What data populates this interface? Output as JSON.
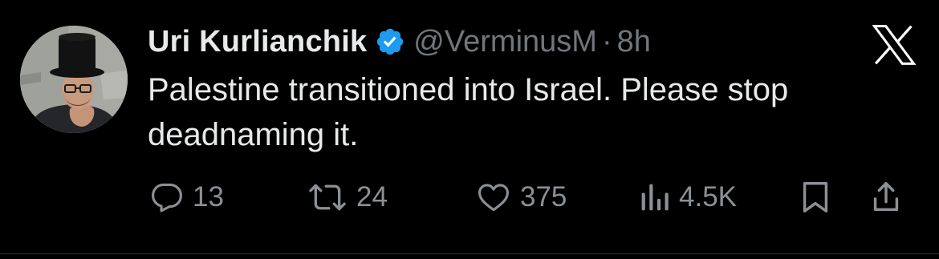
{
  "tweet": {
    "author": {
      "display_name": "Uri Kurlianchik",
      "handle": "@VerminusM",
      "verified": true,
      "separator": "·",
      "time": "8h"
    },
    "text": "Palestine transitioned into Israel. Please stop deadnaming it.",
    "metrics": {
      "replies": "13",
      "reposts": "24",
      "likes": "375",
      "views": "4.5K"
    }
  },
  "icons": {
    "logo": "x-logo-icon",
    "verified": "verified-badge-icon",
    "reply": "reply-icon",
    "repost": "repost-icon",
    "like": "heart-icon",
    "views": "views-icon",
    "bookmark": "bookmark-icon",
    "share": "share-icon"
  },
  "colors": {
    "background": "#000000",
    "primary_text": "#e7e9ea",
    "secondary_text": "#71767b",
    "verified_blue": "#1d9bf0"
  }
}
